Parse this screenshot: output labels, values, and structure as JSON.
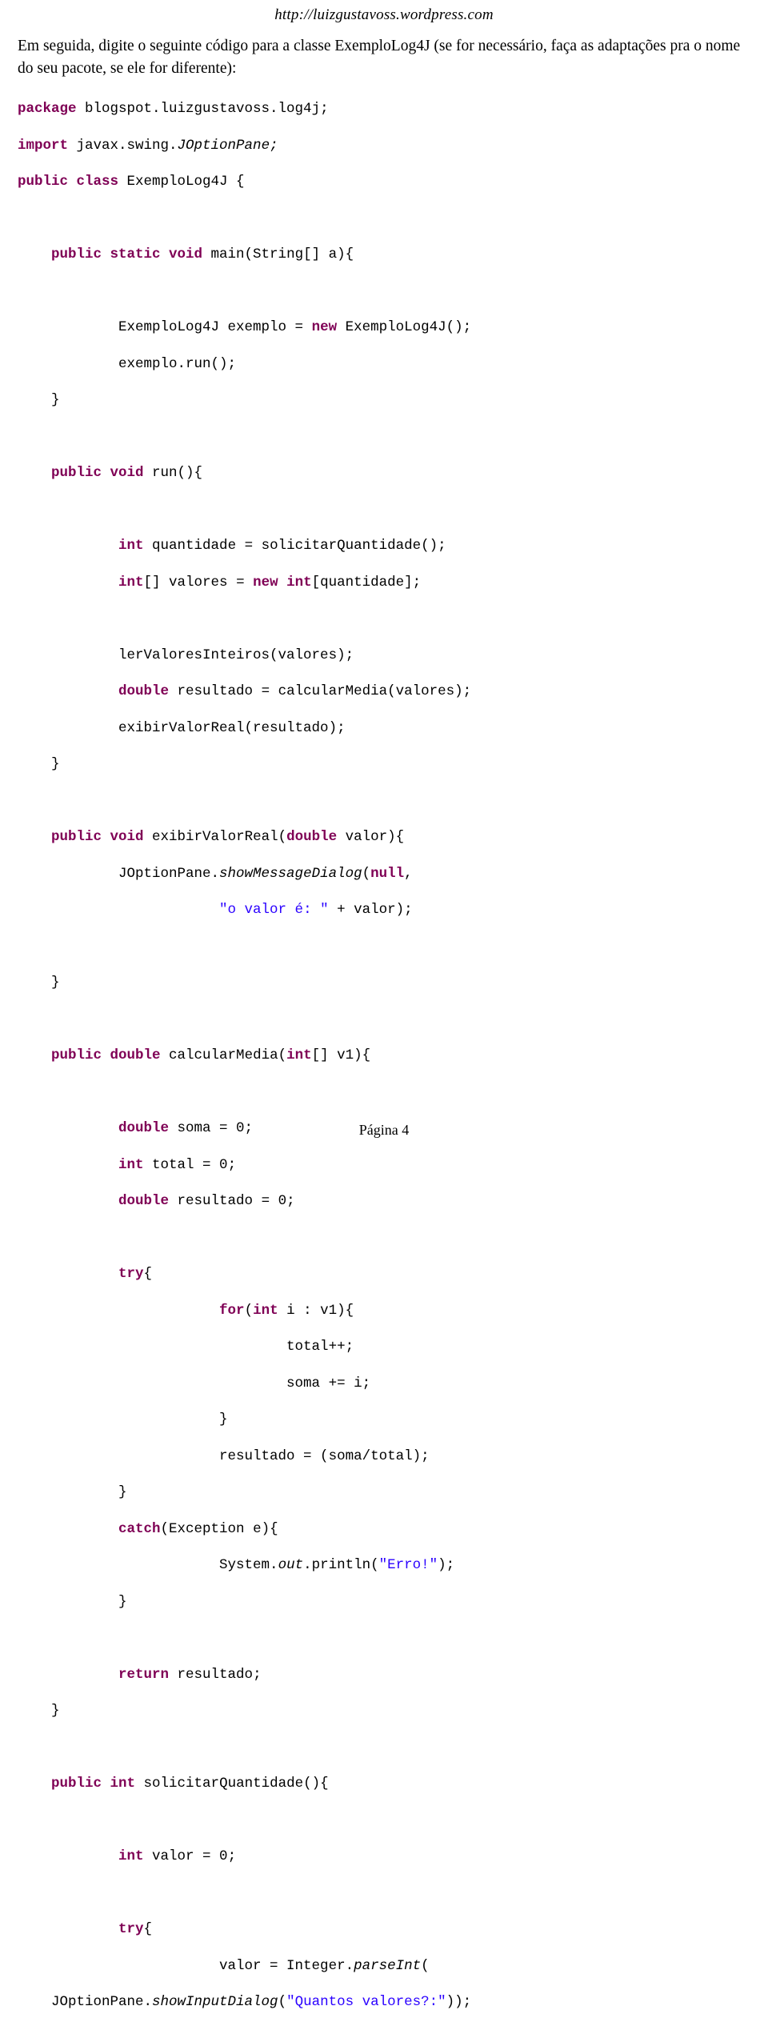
{
  "header": {
    "site_url": "http://luizgustavoss.wordpress.com"
  },
  "intro": {
    "text": "Em seguida, digite o seguinte código para a classe ExemploLog4J (se for necessário, faça as adaptações pra o nome do seu pacote, se ele for diferente):"
  },
  "footer": {
    "page_label": "Página 4"
  },
  "code": {
    "lines": [
      [
        {
          "t": "package",
          "c": "kw"
        },
        {
          "t": " blogspot.luizgustavoss.log4j;",
          "c": ""
        }
      ],
      [
        {
          "t": "import",
          "c": "kw"
        },
        {
          "t": " javax.swing.",
          "c": ""
        },
        {
          "t": "JOptionPane;",
          "c": "ital"
        }
      ],
      [
        {
          "t": "public class",
          "c": "kw"
        },
        {
          "t": " ExemploLog4J {",
          "c": ""
        }
      ],
      [
        {
          "t": "",
          "c": ""
        }
      ],
      [
        {
          "t": "    ",
          "c": ""
        },
        {
          "t": "public static void",
          "c": "kw"
        },
        {
          "t": " main(String[] a){",
          "c": ""
        }
      ],
      [
        {
          "t": "",
          "c": ""
        }
      ],
      [
        {
          "t": "            ExemploLog4J exemplo = ",
          "c": ""
        },
        {
          "t": "new",
          "c": "kw"
        },
        {
          "t": " ExemploLog4J();",
          "c": ""
        }
      ],
      [
        {
          "t": "            exemplo.run();",
          "c": ""
        }
      ],
      [
        {
          "t": "    }",
          "c": ""
        }
      ],
      [
        {
          "t": "",
          "c": ""
        }
      ],
      [
        {
          "t": "    ",
          "c": ""
        },
        {
          "t": "public void",
          "c": "kw"
        },
        {
          "t": " run(){",
          "c": ""
        }
      ],
      [
        {
          "t": "",
          "c": ""
        }
      ],
      [
        {
          "t": "            ",
          "c": ""
        },
        {
          "t": "int",
          "c": "kw"
        },
        {
          "t": " quantidade = solicitarQuantidade();",
          "c": ""
        }
      ],
      [
        {
          "t": "            ",
          "c": ""
        },
        {
          "t": "int",
          "c": "kw"
        },
        {
          "t": "[] valores = ",
          "c": ""
        },
        {
          "t": "new int",
          "c": "kw"
        },
        {
          "t": "[quantidade];",
          "c": ""
        }
      ],
      [
        {
          "t": "",
          "c": ""
        }
      ],
      [
        {
          "t": "            lerValoresInteiros(valores);",
          "c": ""
        }
      ],
      [
        {
          "t": "            ",
          "c": ""
        },
        {
          "t": "double",
          "c": "kw"
        },
        {
          "t": " resultado = calcularMedia(valores);",
          "c": ""
        }
      ],
      [
        {
          "t": "            exibirValorReal(resultado);",
          "c": ""
        }
      ],
      [
        {
          "t": "    }",
          "c": ""
        }
      ],
      [
        {
          "t": "",
          "c": ""
        }
      ],
      [
        {
          "t": "    ",
          "c": ""
        },
        {
          "t": "public void",
          "c": "kw"
        },
        {
          "t": " exibirValorReal(",
          "c": ""
        },
        {
          "t": "double",
          "c": "kw"
        },
        {
          "t": " valor){",
          "c": ""
        }
      ],
      [
        {
          "t": "            JOptionPane.",
          "c": ""
        },
        {
          "t": "showMessageDialog",
          "c": "ital"
        },
        {
          "t": "(",
          "c": ""
        },
        {
          "t": "null",
          "c": "kw"
        },
        {
          "t": ",",
          "c": ""
        }
      ],
      [
        {
          "t": "                        ",
          "c": ""
        },
        {
          "t": "\"o valor é: \"",
          "c": "str"
        },
        {
          "t": " + valor);",
          "c": ""
        }
      ],
      [
        {
          "t": "",
          "c": ""
        }
      ],
      [
        {
          "t": "    }",
          "c": ""
        }
      ],
      [
        {
          "t": "",
          "c": ""
        }
      ],
      [
        {
          "t": "    ",
          "c": ""
        },
        {
          "t": "public double",
          "c": "kw"
        },
        {
          "t": " calcularMedia(",
          "c": ""
        },
        {
          "t": "int",
          "c": "kw"
        },
        {
          "t": "[] v1){",
          "c": ""
        }
      ],
      [
        {
          "t": "",
          "c": ""
        }
      ],
      [
        {
          "t": "            ",
          "c": ""
        },
        {
          "t": "double",
          "c": "kw"
        },
        {
          "t": " soma = 0;",
          "c": ""
        }
      ],
      [
        {
          "t": "            ",
          "c": ""
        },
        {
          "t": "int",
          "c": "kw"
        },
        {
          "t": " total = 0;",
          "c": ""
        }
      ],
      [
        {
          "t": "            ",
          "c": ""
        },
        {
          "t": "double",
          "c": "kw"
        },
        {
          "t": " resultado = 0;",
          "c": ""
        }
      ],
      [
        {
          "t": "",
          "c": ""
        }
      ],
      [
        {
          "t": "            ",
          "c": ""
        },
        {
          "t": "try",
          "c": "kw"
        },
        {
          "t": "{",
          "c": ""
        }
      ],
      [
        {
          "t": "                        ",
          "c": ""
        },
        {
          "t": "for",
          "c": "kw"
        },
        {
          "t": "(",
          "c": ""
        },
        {
          "t": "int",
          "c": "kw"
        },
        {
          "t": " i : v1){",
          "c": ""
        }
      ],
      [
        {
          "t": "                                total++;",
          "c": ""
        }
      ],
      [
        {
          "t": "                                soma += i;",
          "c": ""
        }
      ],
      [
        {
          "t": "                        }",
          "c": ""
        }
      ],
      [
        {
          "t": "                        resultado = (soma/total);",
          "c": ""
        }
      ],
      [
        {
          "t": "            }",
          "c": ""
        }
      ],
      [
        {
          "t": "            ",
          "c": ""
        },
        {
          "t": "catch",
          "c": "kw"
        },
        {
          "t": "(Exception e){",
          "c": ""
        }
      ],
      [
        {
          "t": "                        System.",
          "c": ""
        },
        {
          "t": "out",
          "c": "ital"
        },
        {
          "t": ".println(",
          "c": ""
        },
        {
          "t": "\"Erro!\"",
          "c": "str"
        },
        {
          "t": ");",
          "c": ""
        }
      ],
      [
        {
          "t": "            }",
          "c": ""
        }
      ],
      [
        {
          "t": "",
          "c": ""
        }
      ],
      [
        {
          "t": "            ",
          "c": ""
        },
        {
          "t": "return",
          "c": "kw"
        },
        {
          "t": " resultado;",
          "c": ""
        }
      ],
      [
        {
          "t": "    }",
          "c": ""
        }
      ],
      [
        {
          "t": "",
          "c": ""
        }
      ],
      [
        {
          "t": "    ",
          "c": ""
        },
        {
          "t": "public int",
          "c": "kw"
        },
        {
          "t": " solicitarQuantidade(){",
          "c": ""
        }
      ],
      [
        {
          "t": "",
          "c": ""
        }
      ],
      [
        {
          "t": "            ",
          "c": ""
        },
        {
          "t": "int",
          "c": "kw"
        },
        {
          "t": " valor = 0;",
          "c": ""
        }
      ],
      [
        {
          "t": "",
          "c": ""
        }
      ],
      [
        {
          "t": "            ",
          "c": ""
        },
        {
          "t": "try",
          "c": "kw"
        },
        {
          "t": "{",
          "c": ""
        }
      ],
      [
        {
          "t": "                        valor = Integer.",
          "c": ""
        },
        {
          "t": "parseInt",
          "c": "ital"
        },
        {
          "t": "(",
          "c": ""
        }
      ],
      [
        {
          "t": "    JOptionPane.",
          "c": ""
        },
        {
          "t": "showInputDialog",
          "c": "ital"
        },
        {
          "t": "(",
          "c": ""
        },
        {
          "t": "\"Quantos valores?:\"",
          "c": "str"
        },
        {
          "t": "));",
          "c": ""
        }
      ]
    ]
  }
}
